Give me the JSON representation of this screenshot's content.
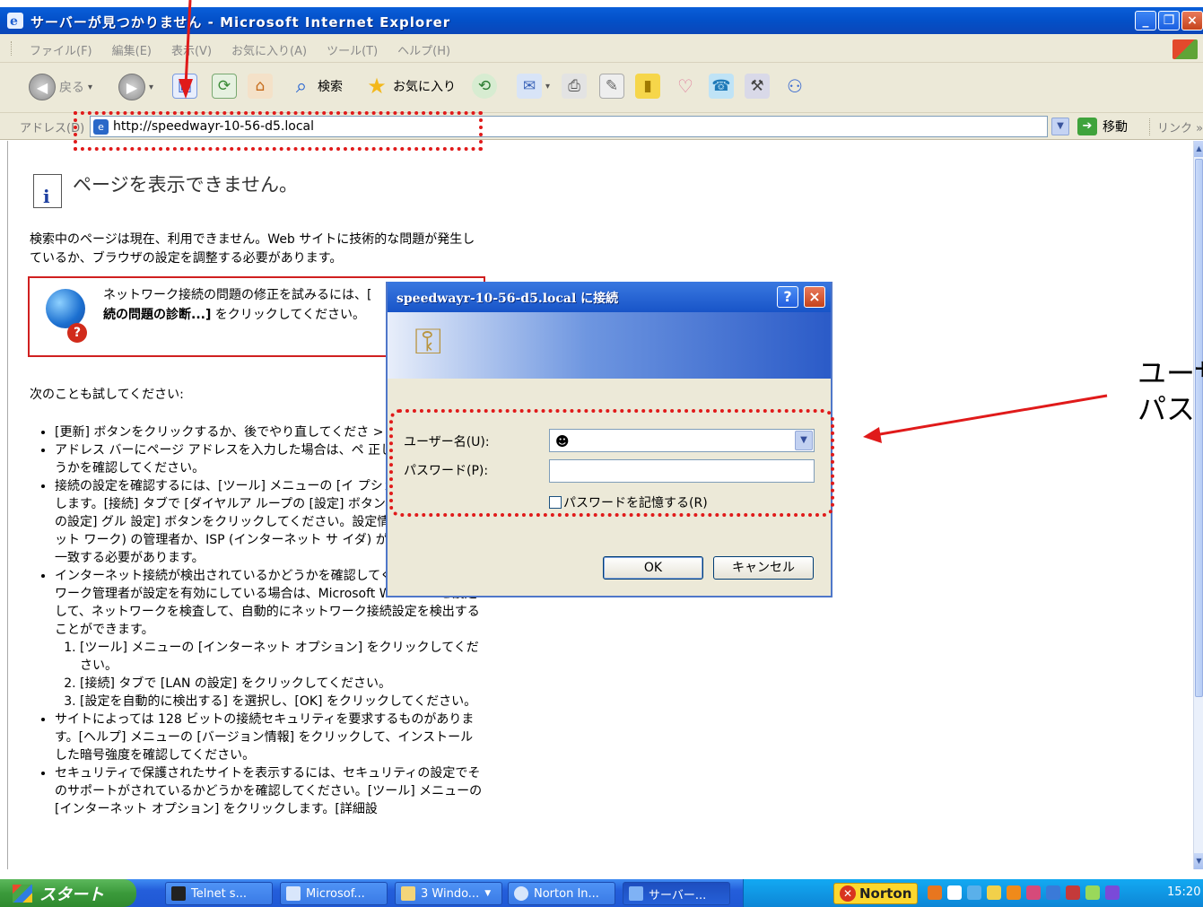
{
  "window": {
    "title": "サーバーが見つかりません - Microsoft Internet Explorer",
    "minimize": "_",
    "maximize": "❐",
    "close": "×"
  },
  "menu": [
    "ファイル(F)",
    "編集(E)",
    "表示(V)",
    "お気に入り(A)",
    "ツール(T)",
    "ヘルプ(H)"
  ],
  "toolbar": {
    "back": "戻る",
    "search": "検索",
    "favorites": "お気に入り"
  },
  "address": {
    "label": "アドレス(D)",
    "url": "http://speedwayr-10-56-d5.local",
    "go": "移動",
    "links": "リンク »"
  },
  "page": {
    "heading": "ページを表示できません。",
    "intro": "検索中のページは現在、利用できません。Web サイトに技術的な問題が発生しているか、ブラウザの設定を調整する必要があります。",
    "netbox_text_1": "ネットワーク接続の問題の修正を試みるには、[",
    "netbox_text_2": "続の問題の診断...]",
    "netbox_text_3": " をクリックしてください。",
    "subhead": "次のことも試してください:",
    "tips": [
      "[更新] ボタンをクリックするか、後でやり直してくださ >",
      "アドレス バーにページ アドレスを入力した場合は、ペ 正しく入力したかどうかを確認してください。",
      "接続の設定を確認するには、[ツール] メニューの [イ プション] をクリックします。[接続] タブで [ダイヤルア ループの [設定] ボタン、または [LAN の設定] グル 設定] ボタンをクリックしてください。設定情報は、LA リアネット ワーク) の管理者か、ISP (インターネット サ イダ) が提供する情報と一致する必要があります。",
      "インターネット接続が検出されているかどうかを確認してください。ネットワーク管理者が設定を有効にしている場合は、Microsoft Windows を設定して、ネットワークを検査して、自動的にネットワーク接続設定を検出することができます。",
      "サイトによっては 128 ビットの接続セキュリティを要求するものがあります。[ヘルプ] メニューの [バージョン情報] をクリックして、インストールした暗号強度を確認してください。",
      "セキュリティで保護されたサイトを表示するには、セキュリティの設定でそのサポートがされているかどうかを確認してください。[ツール] メニューの [インターネット オプション] をクリックします。[詳細設"
    ],
    "steps": [
      "[ツール] メニューの [インターネット オプション] をクリックしてください。",
      "[接続] タブで [LAN の設定] をクリックしてください。",
      "[設定を自動的に検出する] を選択し、[OK] をクリックしてください。"
    ]
  },
  "dialog": {
    "title": "speedwayr-10-56-d5.local に接続",
    "help": "?",
    "close": "×",
    "user_label": "ユーザー名(U):",
    "password_label": "パスワード(P):",
    "remember_label": "パスワードを記憶する(R)",
    "remember_checked": false,
    "ok": "OK",
    "cancel": "キャンセル"
  },
  "annotation": {
    "text": "ユーザ\nパス",
    "color": "#e01a1a"
  },
  "taskbar": {
    "start": "スタート",
    "buttons": [
      "Telnet s...",
      "Microsof...",
      "3 Windo...",
      "Norton In...",
      "サーバー..."
    ],
    "tray_norton": "Norton",
    "clock": "15:20"
  }
}
